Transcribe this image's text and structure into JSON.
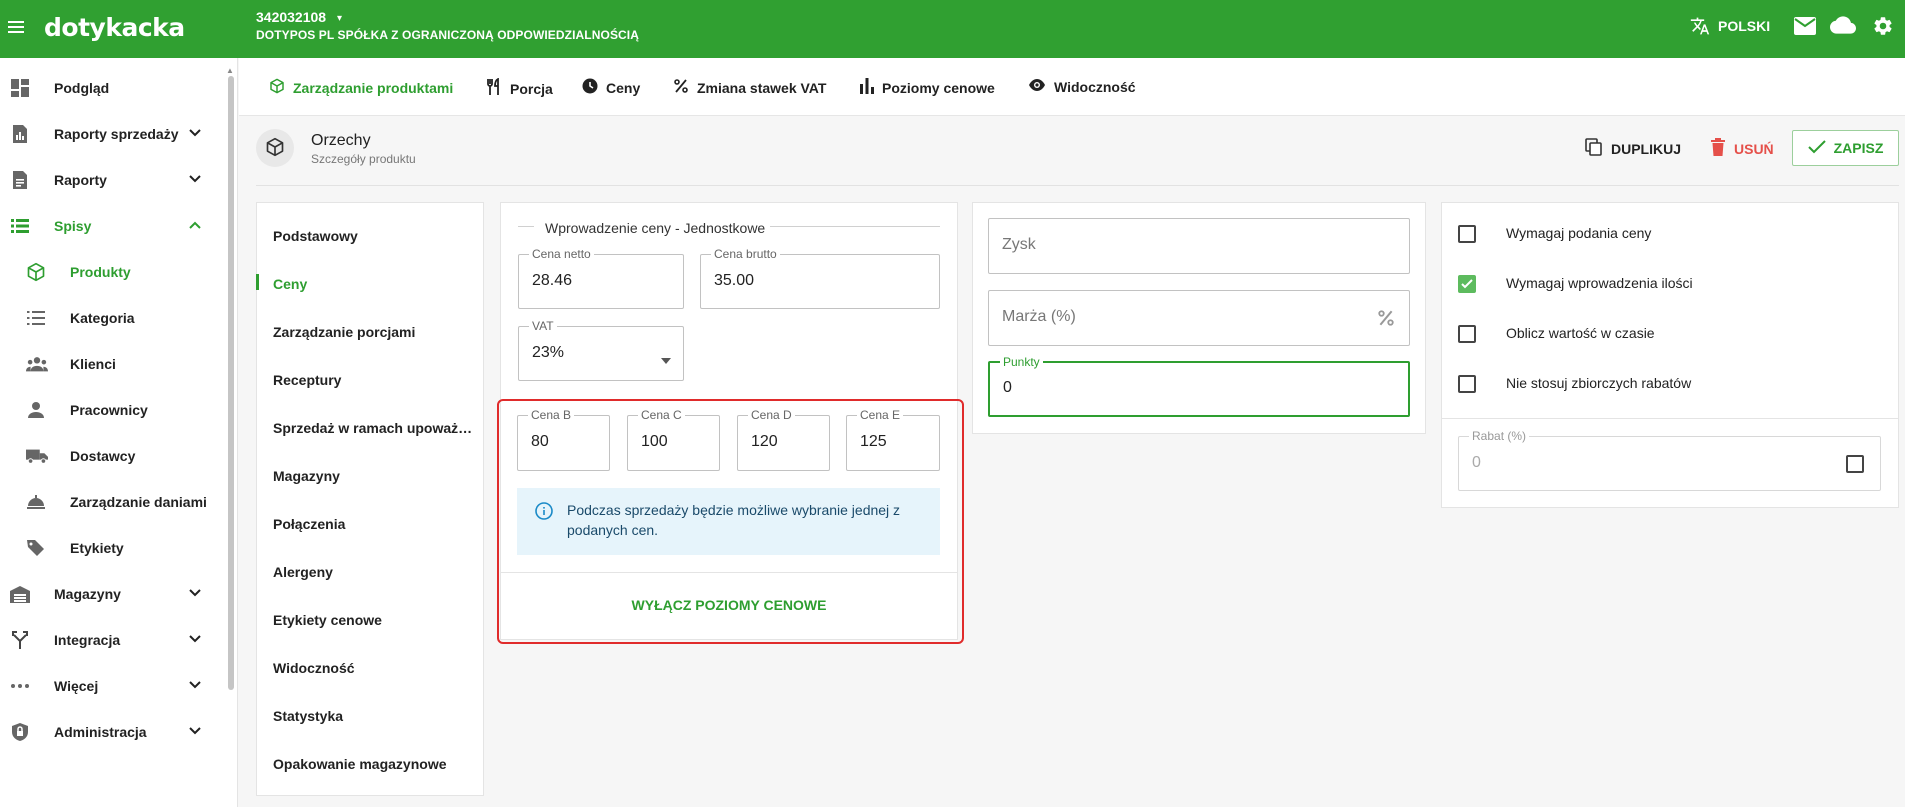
{
  "topbar": {
    "logo": "dotykacka",
    "account_id": "342032108",
    "account_caret": "▾",
    "company": "DOTYPOS PL SPÓŁKA Z OGRANICZONĄ ODPOWIEDZIALNOŚCIĄ",
    "language": "POLSKI",
    "bg_color": "#30a031"
  },
  "sidebar": {
    "items": [
      {
        "label": "Podgląd",
        "icon": "dashboard-icon"
      },
      {
        "label": "Raporty sprzedaży",
        "icon": "sales-report-icon"
      },
      {
        "label": "Raporty",
        "icon": "document-icon"
      },
      {
        "label": "Spisy",
        "icon": "list-icon"
      },
      {
        "label": "Produkty",
        "icon": "cube-icon"
      },
      {
        "label": "Kategoria",
        "icon": "category-list-icon"
      },
      {
        "label": "Klienci",
        "icon": "people-icon"
      },
      {
        "label": "Pracownicy",
        "icon": "person-icon"
      },
      {
        "label": "Dostawcy",
        "icon": "truck-icon"
      },
      {
        "label": "Zarządzanie daniami",
        "icon": "dish-icon"
      },
      {
        "label": "Etykiety",
        "icon": "tag-icon"
      },
      {
        "label": "Magazyny",
        "icon": "warehouse-icon"
      },
      {
        "label": "Integracja",
        "icon": "merge-icon"
      },
      {
        "label": "Więcej",
        "icon": "more-icon"
      },
      {
        "label": "Administracja",
        "icon": "shield-lock-icon"
      }
    ]
  },
  "tabs": [
    {
      "label": "Zarządzanie produktami",
      "icon": "cube-icon"
    },
    {
      "label": "Porcja",
      "icon": "cutlery-icon"
    },
    {
      "label": "Ceny",
      "icon": "clock-icon"
    },
    {
      "label": "Zmiana stawek VAT",
      "icon": "percent-icon"
    },
    {
      "label": "Poziomy cenowe",
      "icon": "bar-chart-icon"
    },
    {
      "label": "Widoczność",
      "icon": "eye-icon"
    }
  ],
  "product": {
    "name": "Orzechy",
    "subtitle": "Szczegóły produktu"
  },
  "actions": {
    "duplicate": "DUPLIKUJ",
    "delete": "USUŃ",
    "save": "ZAPISZ"
  },
  "subnav": [
    "Podstawowy",
    "Ceny",
    "Zarządzanie porcjami",
    "Receptury",
    "Sprzedaż w ramach upoważ…",
    "Magazyny",
    "Połączenia",
    "Alergeny",
    "Etykiety cenowe",
    "Widoczność",
    "Statystyka",
    "Opakowanie magazynowe"
  ],
  "price": {
    "section_title": "Wprowadzenie ceny - Jednostkowe",
    "net_label": "Cena netto",
    "net_value": "28.46",
    "gross_label": "Cena brutto",
    "gross_value": "35.00",
    "vat_label": "VAT",
    "vat_value": "23%",
    "levels": [
      {
        "label": "Cena B",
        "value": "80"
      },
      {
        "label": "Cena C",
        "value": "100"
      },
      {
        "label": "Cena D",
        "value": "120"
      },
      {
        "label": "Cena E",
        "value": "125"
      }
    ],
    "info": "Podczas sprzedaży będzie możliwe wybranie jednej z podanych cen.",
    "disable_button": "WYŁĄCZ POZIOMY CENOWE"
  },
  "profit": {
    "zysk_placeholder": "Zysk",
    "marza_placeholder": "Marża (%)",
    "punkty_label": "Punkty",
    "punkty_value": "0"
  },
  "options": {
    "checkboxes": [
      {
        "label": "Wymagaj podania ceny",
        "checked": false
      },
      {
        "label": "Wymagaj wprowadzenia ilości",
        "checked": true
      },
      {
        "label": "Oblicz wartość w czasie",
        "checked": false
      },
      {
        "label": "Nie stosuj zbiorczych rabatów",
        "checked": false
      }
    ],
    "rabat_label": "Rabat (%)",
    "rabat_value": "0"
  }
}
